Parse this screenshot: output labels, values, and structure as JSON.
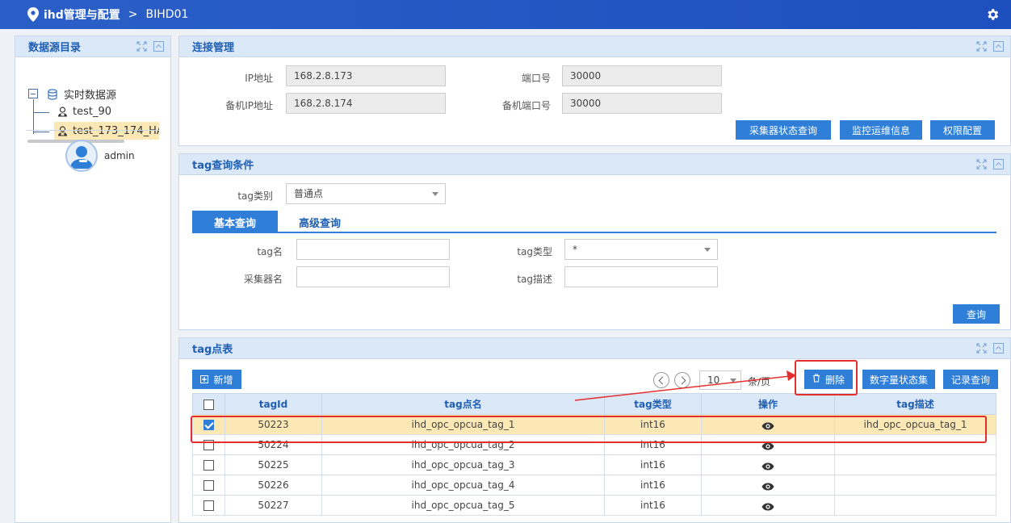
{
  "topbar": {
    "title": "ihd管理与配置",
    "separator": ">",
    "crumb": "BIHD01"
  },
  "left": {
    "panel_title": "数据源目录",
    "tree": {
      "root": "实时数据源",
      "children": [
        "test_90",
        "test_173_174_HA"
      ]
    },
    "user": "admin"
  },
  "conn": {
    "title": "连接管理",
    "ip_label": "IP地址",
    "ip_value": "168.2.8.173",
    "port_label": "端口号",
    "port_value": "30000",
    "backup_ip_label": "备机IP地址",
    "backup_ip_value": "168.2.8.174",
    "backup_port_label": "备机端口号",
    "backup_port_value": "30000",
    "buttons": [
      "采集器状态查询",
      "监控运维信息",
      "权限配置"
    ]
  },
  "query": {
    "title": "tag查询条件",
    "tag_category_label": "tag类别",
    "tag_category_value": "普通点",
    "tabs": [
      "基本查询",
      "高级查询"
    ],
    "tag_name_label": "tag名",
    "tag_type_label": "tag类型",
    "tag_type_value": "*",
    "collector_label": "采集器名",
    "tag_desc_label": "tag描述",
    "search_button": "查询"
  },
  "table": {
    "title": "tag点表",
    "add_button": "新增",
    "page_size": "10",
    "page_size_suffix": "条/页",
    "delete_button": "删除",
    "digital_button": "数字量状态集",
    "record_button": "记录查询",
    "columns": [
      "tagId",
      "tag点名",
      "tag类型",
      "操作",
      "tag描述"
    ],
    "rows": [
      {
        "checked": true,
        "id": "50223",
        "name": "ihd_opc_opcua_tag_1",
        "type": "int16",
        "desc": "ihd_opc_opcua_tag_1"
      },
      {
        "checked": false,
        "id": "50224",
        "name": "ihd_opc_opcua_tag_2",
        "type": "int16",
        "desc": ""
      },
      {
        "checked": false,
        "id": "50225",
        "name": "ihd_opc_opcua_tag_3",
        "type": "int16",
        "desc": ""
      },
      {
        "checked": false,
        "id": "50226",
        "name": "ihd_opc_opcua_tag_4",
        "type": "int16",
        "desc": ""
      },
      {
        "checked": false,
        "id": "50227",
        "name": "ihd_opc_opcua_tag_5",
        "type": "int16",
        "desc": ""
      }
    ]
  },
  "colors": {
    "topbar": "#2b5fc7",
    "accent": "#2f7fd8",
    "selected_row": "#fce8b4",
    "annotation": "#e52e2e"
  },
  "icons": [
    "location-pin-icon",
    "gear-icon",
    "database-icon",
    "user-node-icon",
    "avatar-icon",
    "expand-icon",
    "collapse-icon",
    "add-icon",
    "trash-icon",
    "eye-icon",
    "chevron-left-icon",
    "chevron-right-icon"
  ]
}
